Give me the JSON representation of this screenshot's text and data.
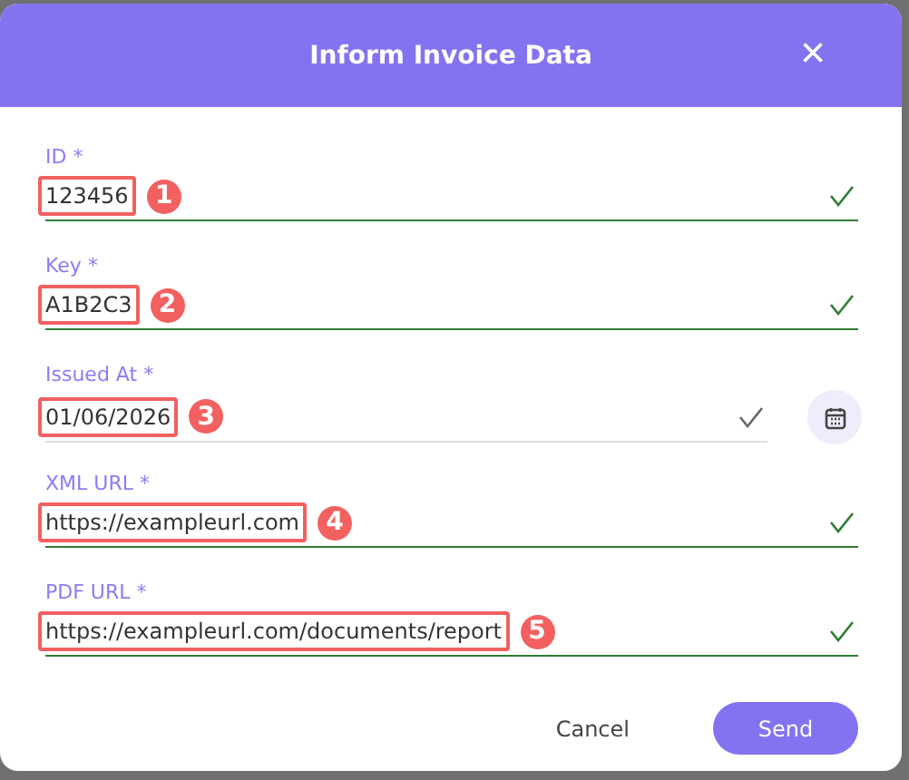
{
  "dialog": {
    "title": "Inform Invoice Data",
    "close": "×"
  },
  "fields": [
    {
      "label": "ID *",
      "value": "123456",
      "kind": "text",
      "valid": true,
      "highlighted": true,
      "marker": "1"
    },
    {
      "label": "Key *",
      "value": "A1B2C3",
      "kind": "text",
      "valid": true,
      "highlighted": true,
      "marker": "2"
    },
    {
      "label": "Issued At *",
      "value": "01/06/2026",
      "kind": "date",
      "valid": false,
      "highlighted": true,
      "marker": "3"
    },
    {
      "label": "XML URL *",
      "value": "https://exampleurl.com",
      "kind": "text",
      "valid": true,
      "highlighted": true,
      "marker": "4"
    },
    {
      "label": "PDF URL *",
      "value": "https://exampleurl.com/documents/report",
      "kind": "text",
      "valid": true,
      "highlighted": true,
      "marker": "5"
    }
  ],
  "buttons": [
    {
      "label": "Cancel",
      "kind": "text"
    },
    {
      "label": "Send",
      "kind": "primary"
    }
  ]
}
